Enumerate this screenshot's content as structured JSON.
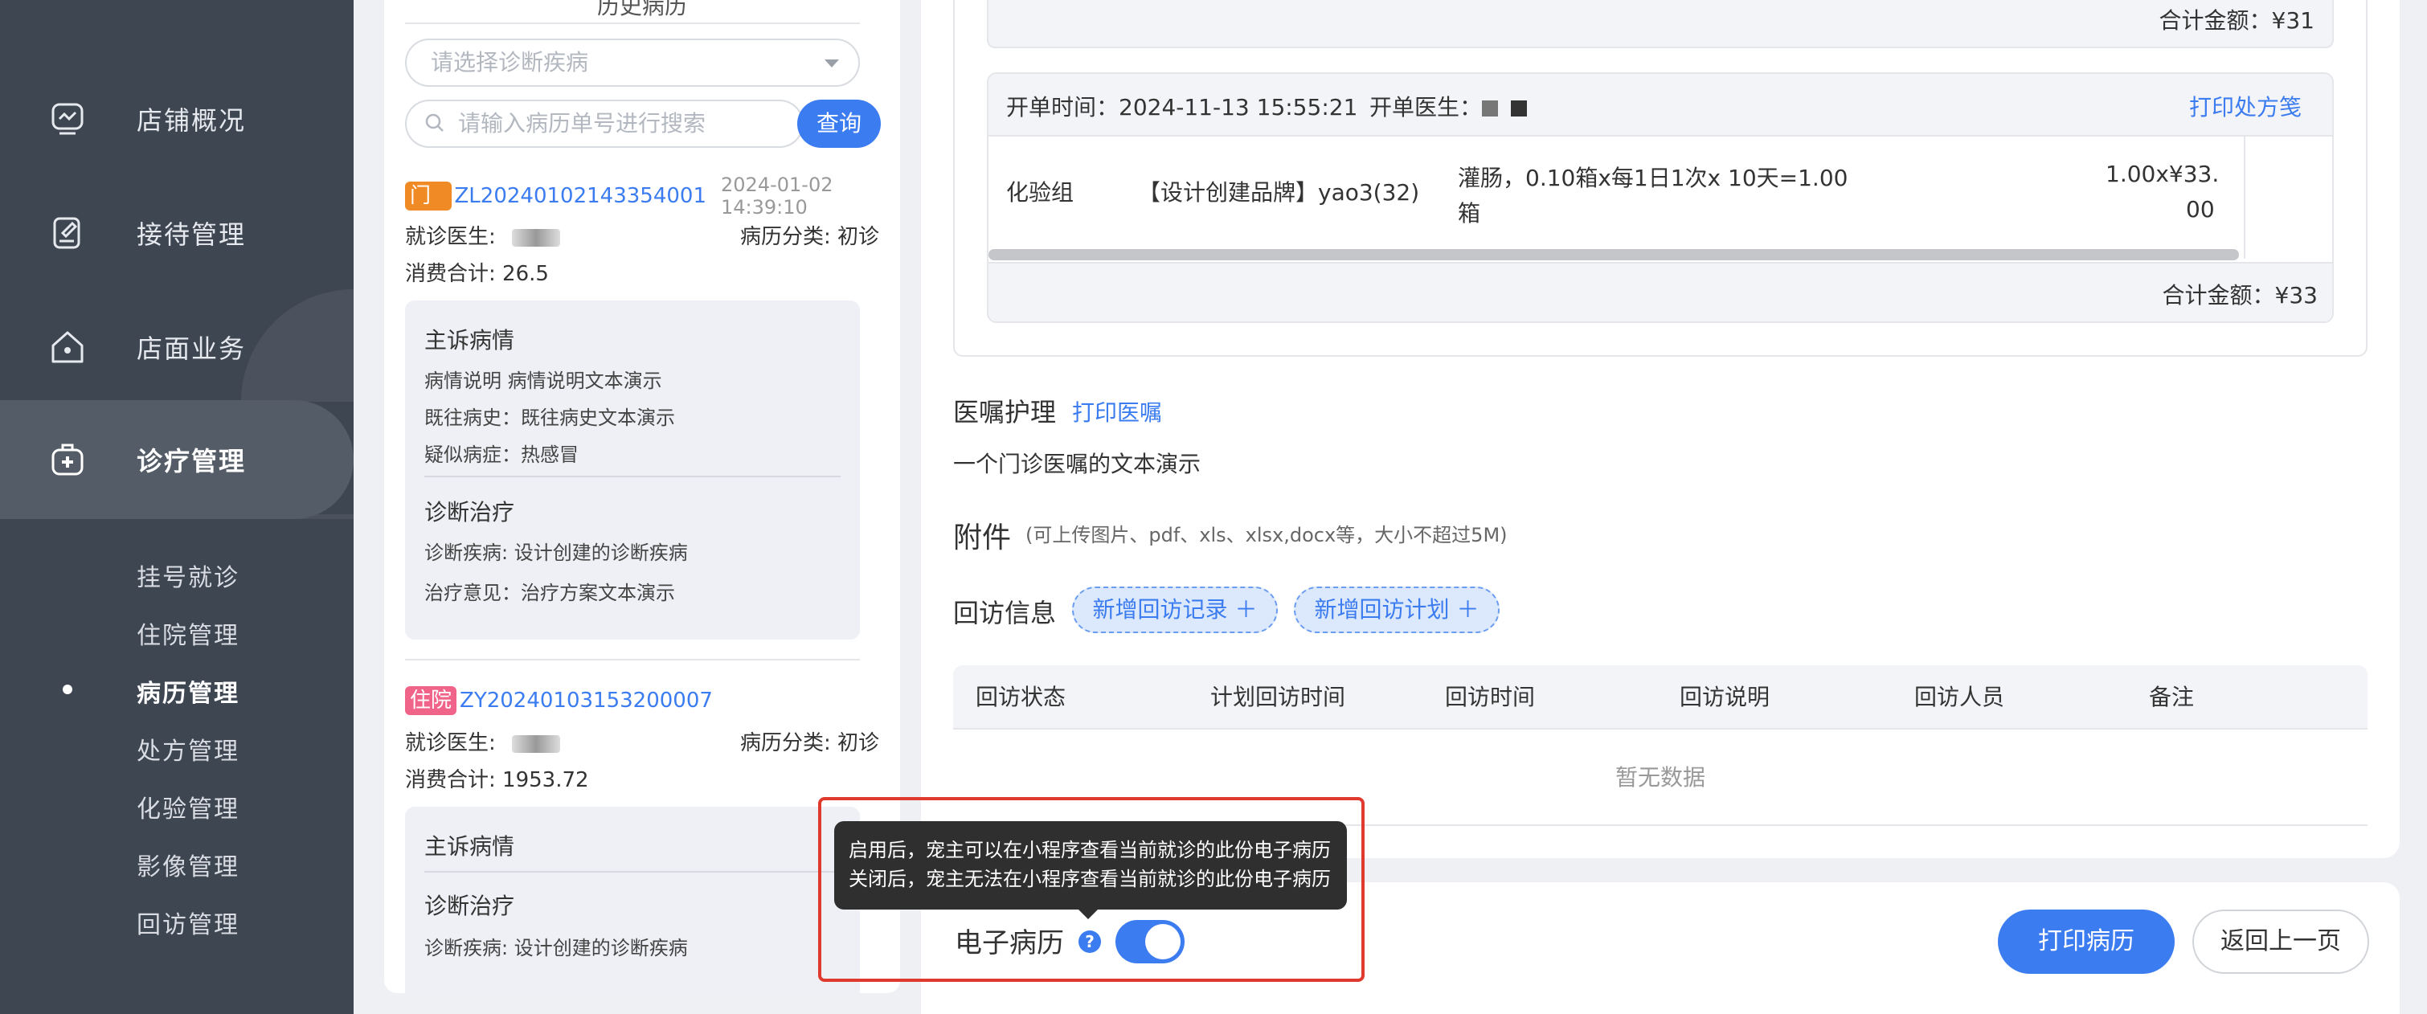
{
  "sidebar": {
    "items": [
      {
        "label": "店铺概况",
        "icon": "store-overview-icon"
      },
      {
        "label": "接待管理",
        "icon": "reception-icon"
      },
      {
        "label": "店面业务",
        "icon": "home-business-icon"
      },
      {
        "label": "诊疗管理",
        "icon": "medical-kit-icon"
      }
    ],
    "sub_items": [
      "挂号就诊",
      "住院管理",
      "病历管理",
      "处方管理",
      "化验管理",
      "影像管理",
      "回访管理"
    ],
    "active_sub": "病历管理"
  },
  "record_list": {
    "title": "历史病历",
    "disease_placeholder": "请选择诊断疾病",
    "search_placeholder": "请输入病历单号进行搜索",
    "query_label": "查询",
    "records": [
      {
        "tag": "门诊",
        "number": "ZL20240102143354001",
        "date": "2024-01-02 14:39:10",
        "doctor_label": "就诊医生:",
        "category": "病历分类: 初诊",
        "total": "消费合计: 26.5",
        "complaint_title": "主诉病情",
        "complaint_lines": [
          "病情说明  病情说明文本演示",
          "既往病史：既往病史文本演示",
          "疑似病症：热感冒"
        ],
        "diagnosis_title": "诊断治疗",
        "diagnosis_lines": [
          "诊断疾病: 设计创建的诊断疾病",
          "治疗意见：治疗方案文本演示"
        ]
      },
      {
        "tag": "住院",
        "number": "ZY20240103153200007",
        "doctor_label": "就诊医生:",
        "category": "病历分类: 初诊",
        "total": "消费合计: 1953.72",
        "complaint_title": "主诉病情",
        "diagnosis_title": "诊断治疗",
        "diagnosis_lines": [
          "诊断疾病: 设计创建的诊断疾病"
        ]
      }
    ]
  },
  "prescription": {
    "prev_total": "合计金额：¥31",
    "open_time": "开单时间：2024-11-13 15:55:21",
    "doctor_label": "开单医生：",
    "print_label": "打印处方笺",
    "row": {
      "group": "化验组",
      "drug": "【设计创建品牌】yao3(32)",
      "usage_line1": "灌肠，0.10箱x每1日1次x 10天=1.00",
      "usage_line2": "箱",
      "qty_line1": "1.00x¥33.",
      "qty_line2": "00"
    },
    "total": "合计金额：¥33"
  },
  "orders": {
    "title": "医嘱护理",
    "print_label": "打印医嘱",
    "text": "一个门诊医嘱的文本演示"
  },
  "attachment": {
    "title": "附件",
    "hint": "(可上传图片、pdf、xls、xlsx,docx等，大小不超过5M)"
  },
  "followup": {
    "title": "回访信息",
    "add_record": "新增回访记录 ＋",
    "add_plan": "新增回访计划 ＋",
    "columns": [
      "回访状态",
      "计划回访时间",
      "回访时间",
      "回访说明",
      "回访人员",
      "备注"
    ],
    "empty": "暂无数据"
  },
  "footer": {
    "tooltip_line1": "启用后，宠主可以在小程序查看当前就诊的此份电子病历",
    "tooltip_line2": "关闭后，宠主无法在小程序查看当前就诊的此份电子病历",
    "ebl_label": "电子病历",
    "help_glyph": "?",
    "ebl_enabled": true,
    "print_label": "打印病历",
    "back_label": "返回上一页"
  },
  "colors": {
    "accent": "#3b7cf0",
    "sidebar_bg": "#3e4652",
    "highlight": "#e03a2e"
  }
}
